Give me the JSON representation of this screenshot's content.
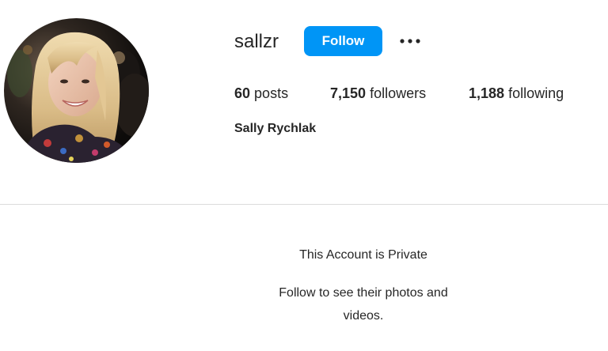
{
  "profile": {
    "username": "sallzr",
    "full_name": "Sally Rychlak",
    "avatar_alt": "profile-photo"
  },
  "actions": {
    "follow_label": "Follow",
    "more_icon": "more-options-icon"
  },
  "stats": {
    "posts_count": "60",
    "posts_label": "posts",
    "followers_count": "7,150",
    "followers_label": "followers",
    "following_count": "1,188",
    "following_label": "following"
  },
  "private_notice": {
    "title": "This Account is Private",
    "subtitle": "Follow to see their photos and videos."
  },
  "colors": {
    "accent": "#0095f6",
    "text": "#262626",
    "divider": "#dbdbdb"
  }
}
